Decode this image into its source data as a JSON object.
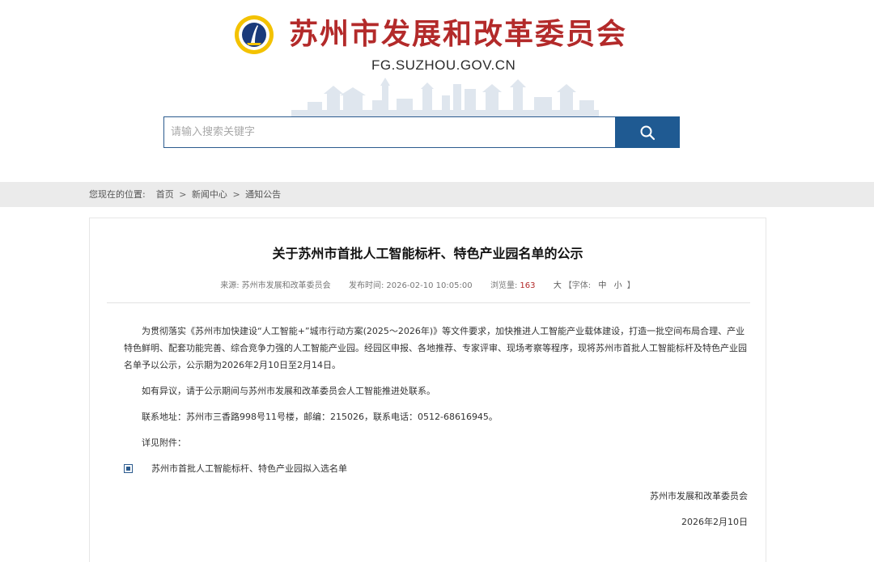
{
  "header": {
    "site_title": "苏州市发展和改革委员会",
    "domain": "FG.SUZHOU.GOV.CN",
    "logo_icon": "emblem-icon"
  },
  "search": {
    "placeholder": "请输入搜索关键字",
    "button_icon": "search-icon",
    "accent": "#1f5a92"
  },
  "breadcrumb": {
    "prefix": "您现在的位置:",
    "items": [
      "首页",
      "新闻中心",
      "通知公告"
    ],
    "separator": ">"
  },
  "article": {
    "title": "关于苏州市首批人工智能标杆、特色产业园名单的公示",
    "meta": {
      "source_label": "来源:",
      "source": "苏州市发展和改革委员会",
      "time_label": "发布时间:",
      "time": "2026-02-10 10:05:00",
      "views_label": "浏览量:",
      "views": "163",
      "font_large": "大",
      "font_open": "【字体:",
      "font_mid": "中",
      "font_small": "小",
      "font_close": "】"
    },
    "paragraphs": [
      "为贯彻落实《苏州市加快建设“人工智能+”城市行动方案(2025～2026年)》等文件要求，加快推进人工智能产业载体建设，打造一批空间布局合理、产业特色鲜明、配套功能完善、综合竞争力强的人工智能产业园。经园区申报、各地推荐、专家评审、现场考察等程序，现将苏州市首批人工智能标杆及特色产业园名单予以公示，公示期为2026年2月10日至2月14日。",
      "如有异议，请于公示期间与苏州市发展和改革委员会人工智能推进处联系。",
      "联系地址：苏州市三香路998号11号楼，邮编：215026，联系电话：0512-68616945。",
      "详见附件："
    ],
    "attachment": "苏州市首批人工智能标杆、特色产业园拟入选名单",
    "signature": "苏州市发展和改革委员会",
    "date": "2026年2月10日"
  },
  "colors": {
    "title_red": "#b32a2a",
    "nav_blue": "#1f5a92",
    "breadcrumb_bg": "#ebebeb"
  }
}
